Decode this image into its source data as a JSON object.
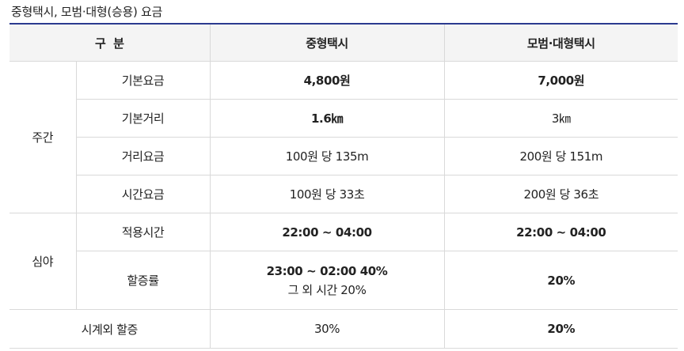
{
  "caption": "중형택시, 모범·대형(승용) 요금",
  "header": {
    "category": "구  분",
    "col1": "중형택시",
    "col2": "모범·대형택시"
  },
  "day": {
    "label": "주간",
    "rows": [
      {
        "item": "기본요금",
        "mid": "4,800원",
        "large": "7,000원"
      },
      {
        "item": "기본거리",
        "mid": "1.6㎞",
        "large": "3㎞"
      },
      {
        "item": "거리요금",
        "mid": "100원 당 135m",
        "large": "200원 당 151m"
      },
      {
        "item": "시간요금",
        "mid": "100원 당 33초",
        "large": "200원 당 36초"
      }
    ]
  },
  "night": {
    "label": "심야",
    "rows": [
      {
        "item": "적용시간",
        "mid": "22:00 ~ 04:00",
        "large": "22:00 ~ 04:00"
      },
      {
        "item": "할증률",
        "mid_line1": "23:00 ~ 02:00 40%",
        "mid_line2": "그 외 시간 20%",
        "large": "20%"
      }
    ]
  },
  "outside": {
    "label": "시계외 할증",
    "mid": "30%",
    "large": "20%"
  }
}
